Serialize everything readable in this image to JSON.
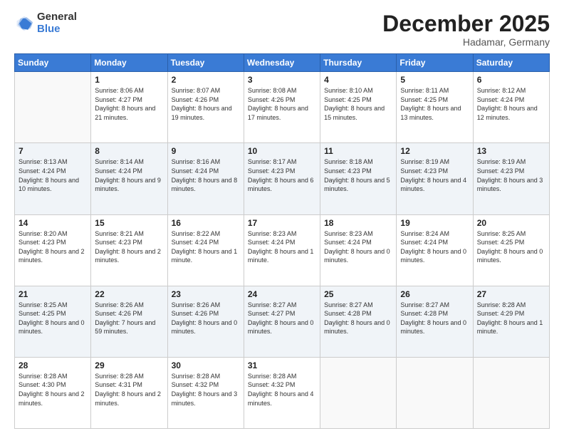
{
  "header": {
    "logo_general": "General",
    "logo_blue": "Blue",
    "month_title": "December 2025",
    "location": "Hadamar, Germany"
  },
  "days_of_week": [
    "Sunday",
    "Monday",
    "Tuesday",
    "Wednesday",
    "Thursday",
    "Friday",
    "Saturday"
  ],
  "weeks": [
    [
      {
        "day": "",
        "sunrise": "",
        "sunset": "",
        "daylight": ""
      },
      {
        "day": "1",
        "sunrise": "Sunrise: 8:06 AM",
        "sunset": "Sunset: 4:27 PM",
        "daylight": "Daylight: 8 hours and 21 minutes."
      },
      {
        "day": "2",
        "sunrise": "Sunrise: 8:07 AM",
        "sunset": "Sunset: 4:26 PM",
        "daylight": "Daylight: 8 hours and 19 minutes."
      },
      {
        "day": "3",
        "sunrise": "Sunrise: 8:08 AM",
        "sunset": "Sunset: 4:26 PM",
        "daylight": "Daylight: 8 hours and 17 minutes."
      },
      {
        "day": "4",
        "sunrise": "Sunrise: 8:10 AM",
        "sunset": "Sunset: 4:25 PM",
        "daylight": "Daylight: 8 hours and 15 minutes."
      },
      {
        "day": "5",
        "sunrise": "Sunrise: 8:11 AM",
        "sunset": "Sunset: 4:25 PM",
        "daylight": "Daylight: 8 hours and 13 minutes."
      },
      {
        "day": "6",
        "sunrise": "Sunrise: 8:12 AM",
        "sunset": "Sunset: 4:24 PM",
        "daylight": "Daylight: 8 hours and 12 minutes."
      }
    ],
    [
      {
        "day": "7",
        "sunrise": "Sunrise: 8:13 AM",
        "sunset": "Sunset: 4:24 PM",
        "daylight": "Daylight: 8 hours and 10 minutes."
      },
      {
        "day": "8",
        "sunrise": "Sunrise: 8:14 AM",
        "sunset": "Sunset: 4:24 PM",
        "daylight": "Daylight: 8 hours and 9 minutes."
      },
      {
        "day": "9",
        "sunrise": "Sunrise: 8:16 AM",
        "sunset": "Sunset: 4:24 PM",
        "daylight": "Daylight: 8 hours and 8 minutes."
      },
      {
        "day": "10",
        "sunrise": "Sunrise: 8:17 AM",
        "sunset": "Sunset: 4:23 PM",
        "daylight": "Daylight: 8 hours and 6 minutes."
      },
      {
        "day": "11",
        "sunrise": "Sunrise: 8:18 AM",
        "sunset": "Sunset: 4:23 PM",
        "daylight": "Daylight: 8 hours and 5 minutes."
      },
      {
        "day": "12",
        "sunrise": "Sunrise: 8:19 AM",
        "sunset": "Sunset: 4:23 PM",
        "daylight": "Daylight: 8 hours and 4 minutes."
      },
      {
        "day": "13",
        "sunrise": "Sunrise: 8:19 AM",
        "sunset": "Sunset: 4:23 PM",
        "daylight": "Daylight: 8 hours and 3 minutes."
      }
    ],
    [
      {
        "day": "14",
        "sunrise": "Sunrise: 8:20 AM",
        "sunset": "Sunset: 4:23 PM",
        "daylight": "Daylight: 8 hours and 2 minutes."
      },
      {
        "day": "15",
        "sunrise": "Sunrise: 8:21 AM",
        "sunset": "Sunset: 4:23 PM",
        "daylight": "Daylight: 8 hours and 2 minutes."
      },
      {
        "day": "16",
        "sunrise": "Sunrise: 8:22 AM",
        "sunset": "Sunset: 4:24 PM",
        "daylight": "Daylight: 8 hours and 1 minute."
      },
      {
        "day": "17",
        "sunrise": "Sunrise: 8:23 AM",
        "sunset": "Sunset: 4:24 PM",
        "daylight": "Daylight: 8 hours and 1 minute."
      },
      {
        "day": "18",
        "sunrise": "Sunrise: 8:23 AM",
        "sunset": "Sunset: 4:24 PM",
        "daylight": "Daylight: 8 hours and 0 minutes."
      },
      {
        "day": "19",
        "sunrise": "Sunrise: 8:24 AM",
        "sunset": "Sunset: 4:24 PM",
        "daylight": "Daylight: 8 hours and 0 minutes."
      },
      {
        "day": "20",
        "sunrise": "Sunrise: 8:25 AM",
        "sunset": "Sunset: 4:25 PM",
        "daylight": "Daylight: 8 hours and 0 minutes."
      }
    ],
    [
      {
        "day": "21",
        "sunrise": "Sunrise: 8:25 AM",
        "sunset": "Sunset: 4:25 PM",
        "daylight": "Daylight: 8 hours and 0 minutes."
      },
      {
        "day": "22",
        "sunrise": "Sunrise: 8:26 AM",
        "sunset": "Sunset: 4:26 PM",
        "daylight": "Daylight: 7 hours and 59 minutes."
      },
      {
        "day": "23",
        "sunrise": "Sunrise: 8:26 AM",
        "sunset": "Sunset: 4:26 PM",
        "daylight": "Daylight: 8 hours and 0 minutes."
      },
      {
        "day": "24",
        "sunrise": "Sunrise: 8:27 AM",
        "sunset": "Sunset: 4:27 PM",
        "daylight": "Daylight: 8 hours and 0 minutes."
      },
      {
        "day": "25",
        "sunrise": "Sunrise: 8:27 AM",
        "sunset": "Sunset: 4:28 PM",
        "daylight": "Daylight: 8 hours and 0 minutes."
      },
      {
        "day": "26",
        "sunrise": "Sunrise: 8:27 AM",
        "sunset": "Sunset: 4:28 PM",
        "daylight": "Daylight: 8 hours and 0 minutes."
      },
      {
        "day": "27",
        "sunrise": "Sunrise: 8:28 AM",
        "sunset": "Sunset: 4:29 PM",
        "daylight": "Daylight: 8 hours and 1 minute."
      }
    ],
    [
      {
        "day": "28",
        "sunrise": "Sunrise: 8:28 AM",
        "sunset": "Sunset: 4:30 PM",
        "daylight": "Daylight: 8 hours and 2 minutes."
      },
      {
        "day": "29",
        "sunrise": "Sunrise: 8:28 AM",
        "sunset": "Sunset: 4:31 PM",
        "daylight": "Daylight: 8 hours and 2 minutes."
      },
      {
        "day": "30",
        "sunrise": "Sunrise: 8:28 AM",
        "sunset": "Sunset: 4:32 PM",
        "daylight": "Daylight: 8 hours and 3 minutes."
      },
      {
        "day": "31",
        "sunrise": "Sunrise: 8:28 AM",
        "sunset": "Sunset: 4:32 PM",
        "daylight": "Daylight: 8 hours and 4 minutes."
      },
      {
        "day": "",
        "sunrise": "",
        "sunset": "",
        "daylight": ""
      },
      {
        "day": "",
        "sunrise": "",
        "sunset": "",
        "daylight": ""
      },
      {
        "day": "",
        "sunrise": "",
        "sunset": "",
        "daylight": ""
      }
    ]
  ]
}
